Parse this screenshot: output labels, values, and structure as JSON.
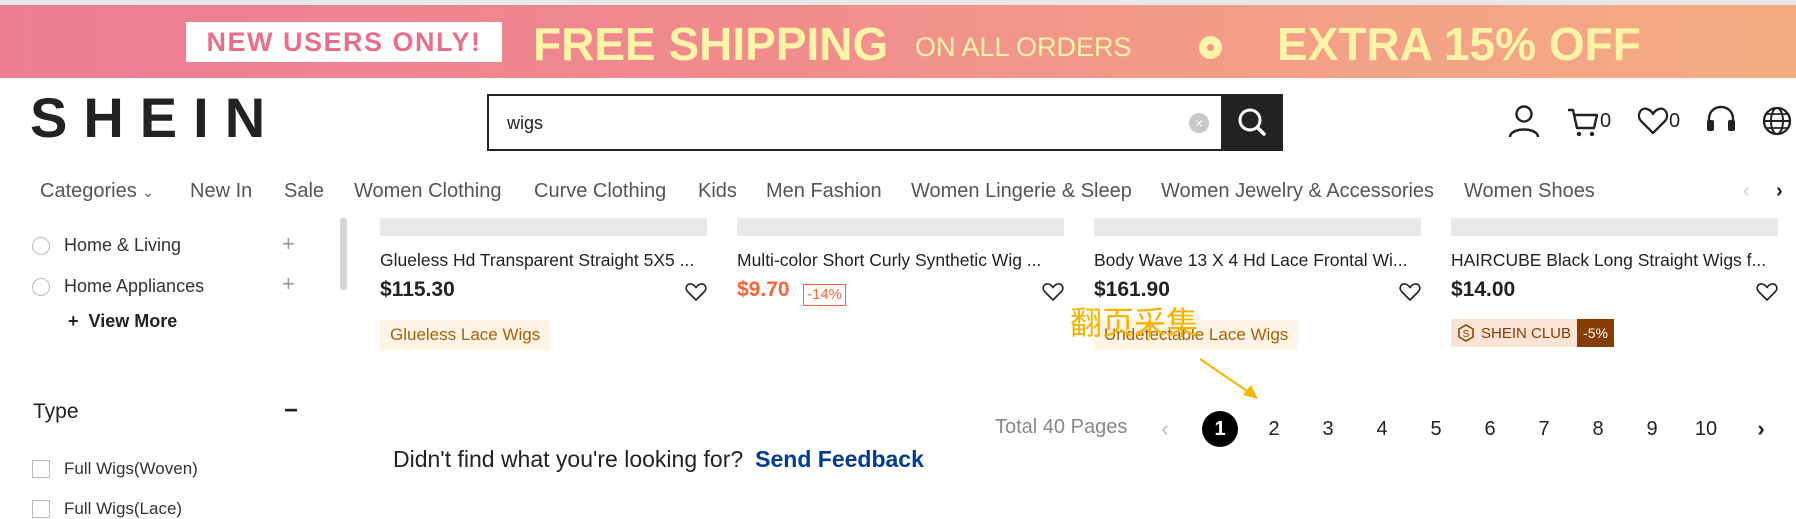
{
  "promo": {
    "new_users": "NEW USERS ONLY!",
    "free_shipping": "FREE SHIPPING",
    "on_all_orders": "ON ALL ORDERS",
    "extra": "EXTRA 15% OFF"
  },
  "header": {
    "logo": "SHEIN",
    "search_value": "wigs",
    "cart_count": "0",
    "wishlist_count": "0",
    "icons": [
      "user-icon",
      "cart-icon",
      "heart-icon",
      "headset-icon",
      "globe-icon"
    ]
  },
  "nav": {
    "items": [
      "Categories",
      "New In",
      "Sale",
      "Women Clothing",
      "Curve Clothing",
      "Kids",
      "Men Fashion",
      "Women Lingerie & Sleep",
      "Women Jewelry & Accessories",
      "Women Shoes"
    ]
  },
  "sidebar": {
    "categories": [
      "Home & Living",
      "Home Appliances"
    ],
    "view_more": "View More",
    "type_heading": "Type",
    "type_options": [
      "Full Wigs(Woven)",
      "Full Wigs(Lace)"
    ]
  },
  "products": [
    {
      "title": "Glueless Hd Transparent Straight 5X5 ...",
      "price": "$115.30",
      "tag": "Glueless Lace Wigs"
    },
    {
      "title": "Multi-color Short Curly Synthetic Wig ...",
      "price": "$9.70",
      "discount": "-14%"
    },
    {
      "title": "Body Wave 13 X 4 Hd Lace Frontal Wi...",
      "price": "$161.90",
      "tag": "Undetectable Lace Wigs"
    },
    {
      "title": "HAIRCUBE Black Long Straight Wigs f...",
      "price": "$14.00",
      "club_label": "SHEIN CLUB",
      "club_discount": "-5%"
    }
  ],
  "annotation": "翻页采集",
  "pagination": {
    "total": "Total 40 Pages",
    "pages": [
      "1",
      "2",
      "3",
      "4",
      "5",
      "6",
      "7",
      "8",
      "9",
      "10"
    ],
    "current": "1"
  },
  "feedback": {
    "question": "Didn't find what you're looking for?",
    "link": "Send Feedback"
  },
  "colors": {
    "sale_red": "#fa6338",
    "annotation_yellow": "#f5b400",
    "link_blue": "#003c8f"
  }
}
